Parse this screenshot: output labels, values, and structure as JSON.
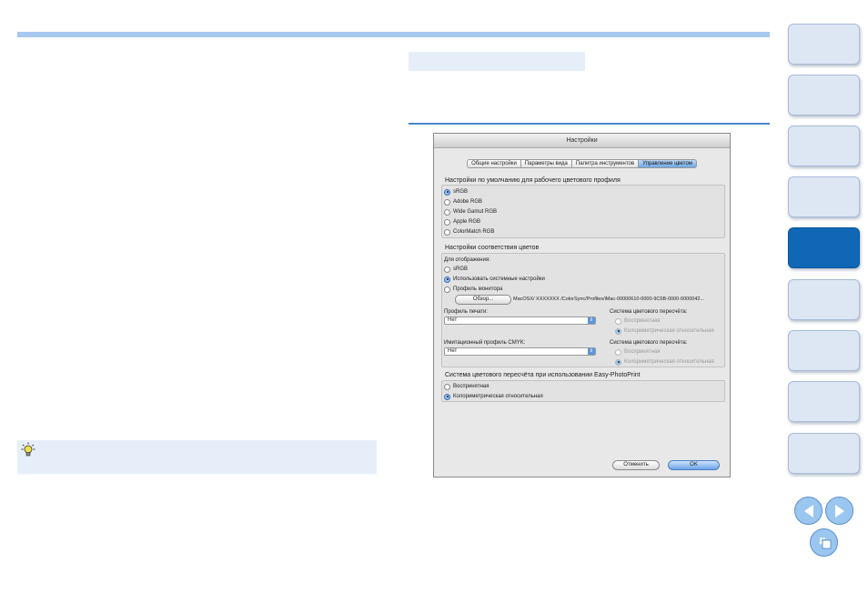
{
  "dialog": {
    "title": "Настройки",
    "tabs": [
      "Общие настройки",
      "Параметры вида",
      "Палитра инструментов",
      "Управление цветом"
    ],
    "active_tab": "Управление цветом",
    "working_space": {
      "title": "Настройки по умолчанию для рабочего цветового профиля",
      "options": [
        "sRGB",
        "Adobe RGB",
        "Wide Gamut RGB",
        "Apple RGB",
        "ColorMatch RGB"
      ],
      "selected": "sRGB"
    },
    "color_matching": {
      "title": "Настройки соответствия цветов",
      "display_label": "Для отображения:",
      "display_options": [
        "sRGB",
        "Использовать системные настройки",
        "Профиль монитора"
      ],
      "display_selected": "Использовать системные настройки",
      "browse_label": "Обзор...",
      "profile_path": "MacOSX/ XXXXXXX /ColorSync/Profiles/iMac-00000610-0000-9C6B-0000-0000042...",
      "print_profile_label": "Профиль печати:",
      "print_profile_value": "Нет",
      "print_intent_label": "Система цветового пересчёта:",
      "intent_options": [
        "Воспринятная",
        "Колориметрическая относительная"
      ],
      "print_intent_selected": "Колориметрическая относительная",
      "cmyk_label": "Имитационный профиль CMYK:",
      "cmyk_value": "Нет",
      "cmyk_intent_label": "Система цветового пересчёта:",
      "cmyk_intent_selected": "Колориметрическая относительная"
    },
    "easy_photoprint": {
      "title": "Система цветового пересчёта при использовании Easy-PhotoPrint",
      "options": [
        "Воспринятная",
        "Колориметрическая относительная"
      ],
      "selected": "Колориметрическая относительная"
    },
    "cancel_label": "Отменить",
    "ok_label": "OK"
  },
  "side_nav": {
    "count": 9,
    "active_index": 4
  },
  "icons": {
    "tip": "lightbulb-icon",
    "prev": "prev-arrow-icon",
    "next": "next-arrow-icon",
    "back": "return-icon"
  },
  "colors": {
    "accent": "#0f67b5",
    "rule": "#a8c8f0",
    "panel": "#e6eff9"
  }
}
